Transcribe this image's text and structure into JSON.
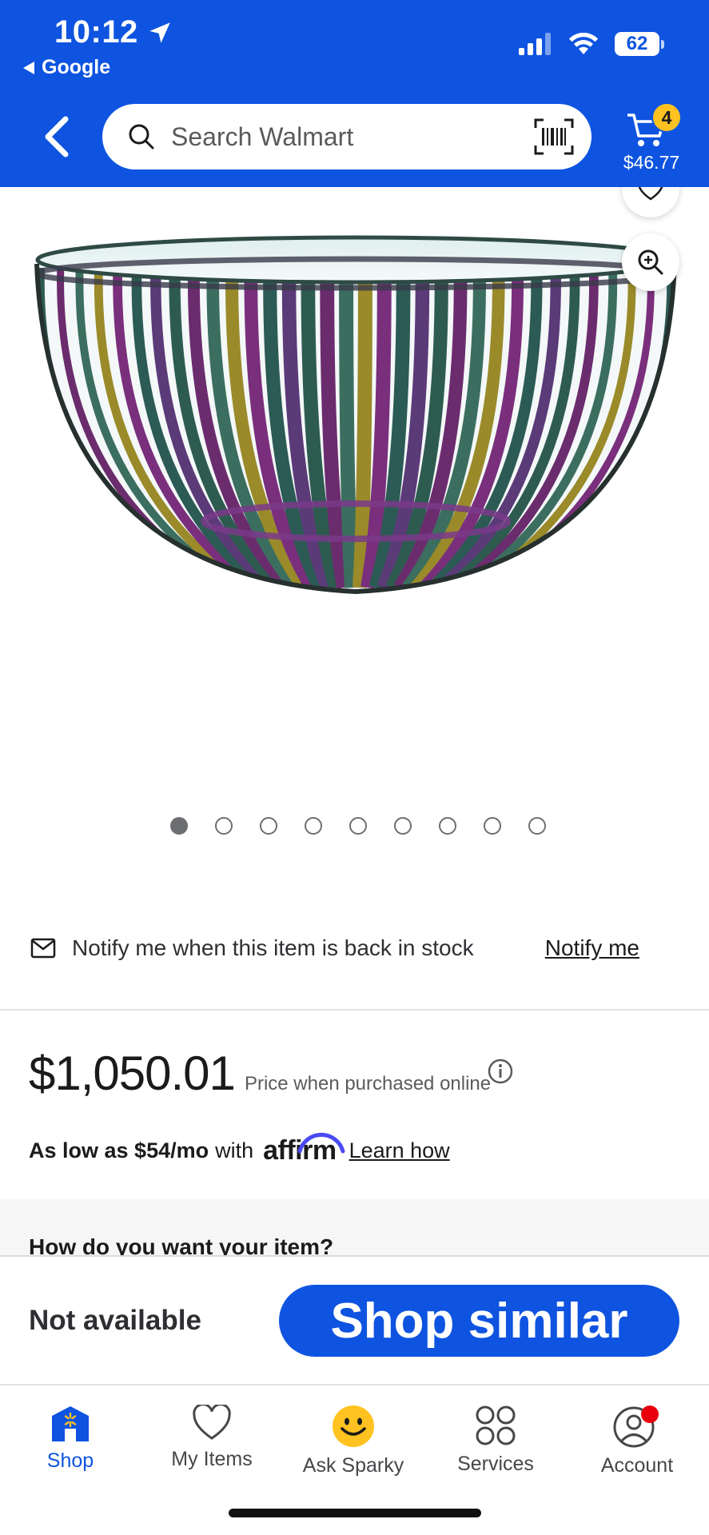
{
  "status_bar": {
    "time": "10:12",
    "back_app": "Google",
    "battery": "62"
  },
  "header": {
    "search_placeholder": "Search Walmart",
    "cart_count": "4",
    "cart_total": "$46.77"
  },
  "gallery": {
    "image_count": 9,
    "active_index": 0
  },
  "notify": {
    "text": "Notify me when this item is back in stock",
    "link": "Notify me"
  },
  "price": {
    "amount": "$1,050.01",
    "note": "Price when purchased online"
  },
  "affirm": {
    "bold": "As low as $54/mo",
    "with": "with",
    "logo": "affirm",
    "link": "Learn how"
  },
  "fulfillment": {
    "question": "How do you want your item?"
  },
  "action_bar": {
    "status": "Not available",
    "button": "Shop similar"
  },
  "tabs": [
    {
      "label": "Shop",
      "icon": "shop-icon",
      "active": true
    },
    {
      "label": "My Items",
      "icon": "heart-icon",
      "active": false
    },
    {
      "label": "Ask Sparky",
      "icon": "sparky-icon",
      "active": false
    },
    {
      "label": "Services",
      "icon": "services-icon",
      "active": false
    },
    {
      "label": "Account",
      "icon": "account-icon",
      "active": false
    }
  ],
  "colors": {
    "brand_blue": "#0e54e0",
    "spark_yellow": "#ffc220",
    "notification_red": "#e8000c"
  }
}
